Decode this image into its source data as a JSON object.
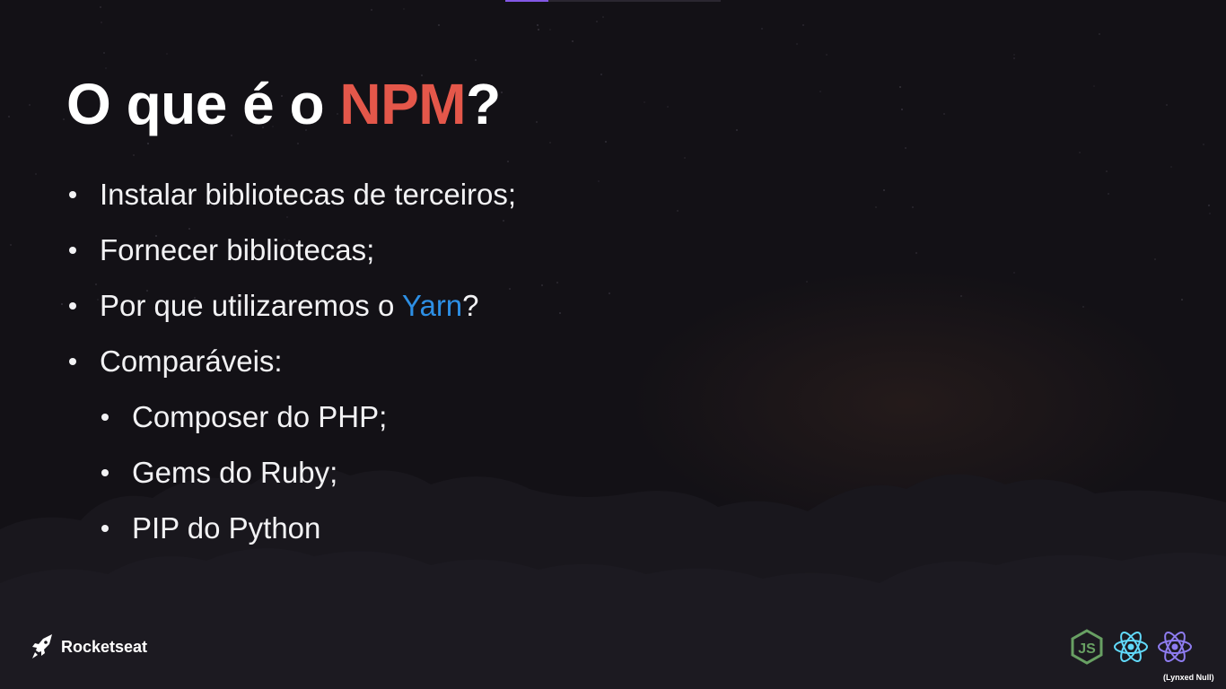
{
  "slide": {
    "title_prefix": "O que é o ",
    "title_highlight": "NPM",
    "title_suffix": "?",
    "bullets": [
      {
        "text": "Instalar bibliotecas de terceiros;"
      },
      {
        "text": "Fornecer bibliotecas;"
      },
      {
        "text_before": "Por que utilizaremos o ",
        "highlight": "Yarn",
        "text_after": "?"
      },
      {
        "text": "Comparáveis:"
      },
      {
        "text": "Composer do PHP;"
      },
      {
        "text": "Gems do Ruby;"
      },
      {
        "text": "PIP do Python"
      }
    ]
  },
  "footer": {
    "brand_name": "Rocketseat",
    "brand_icon": "rocket-logo-icon",
    "tech_icons": [
      "nodejs-icon",
      "react-icon",
      "react-native-icon"
    ],
    "watermark": "(Lynxed Null)"
  },
  "colors": {
    "background": "#131116",
    "title_highlight": "#e4574a",
    "yarn_highlight": "#2d8fe4",
    "nodejs": "#68a063",
    "react": "#61dafb",
    "react_native": "#8e7cf0",
    "top_accent": "#8257e5"
  }
}
